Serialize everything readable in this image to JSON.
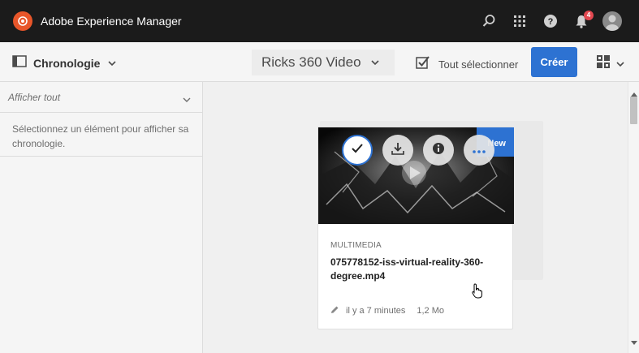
{
  "shell": {
    "title": "Adobe Experience Manager",
    "notification_count": "4",
    "icons": [
      "search-icon",
      "apps-grid-icon",
      "help-icon",
      "bell-icon",
      "user-avatar"
    ]
  },
  "actionbar": {
    "rail_label": "Chronologie",
    "breadcrumb": "Ricks 360 Video",
    "select_all": "Tout sélectionner",
    "create": "Créer"
  },
  "rail": {
    "filter": "Afficher tout",
    "message": "Sélectionnez un élément pour afficher sa chronologie."
  },
  "card": {
    "badge": "New",
    "type": "MULTIMEDIA",
    "filename": "075778152-iss-virtual-reality-360-degree.mp4",
    "modified": "il y a 7 minutes",
    "size": "1,2 Mo",
    "quick_actions": [
      "check-icon",
      "download-icon",
      "info-icon",
      "more-icon"
    ]
  },
  "colors": {
    "accent": "#2d72d2",
    "shell_bg": "#1b1b1b",
    "logo": "#e8562a",
    "badge": "#e34850"
  }
}
